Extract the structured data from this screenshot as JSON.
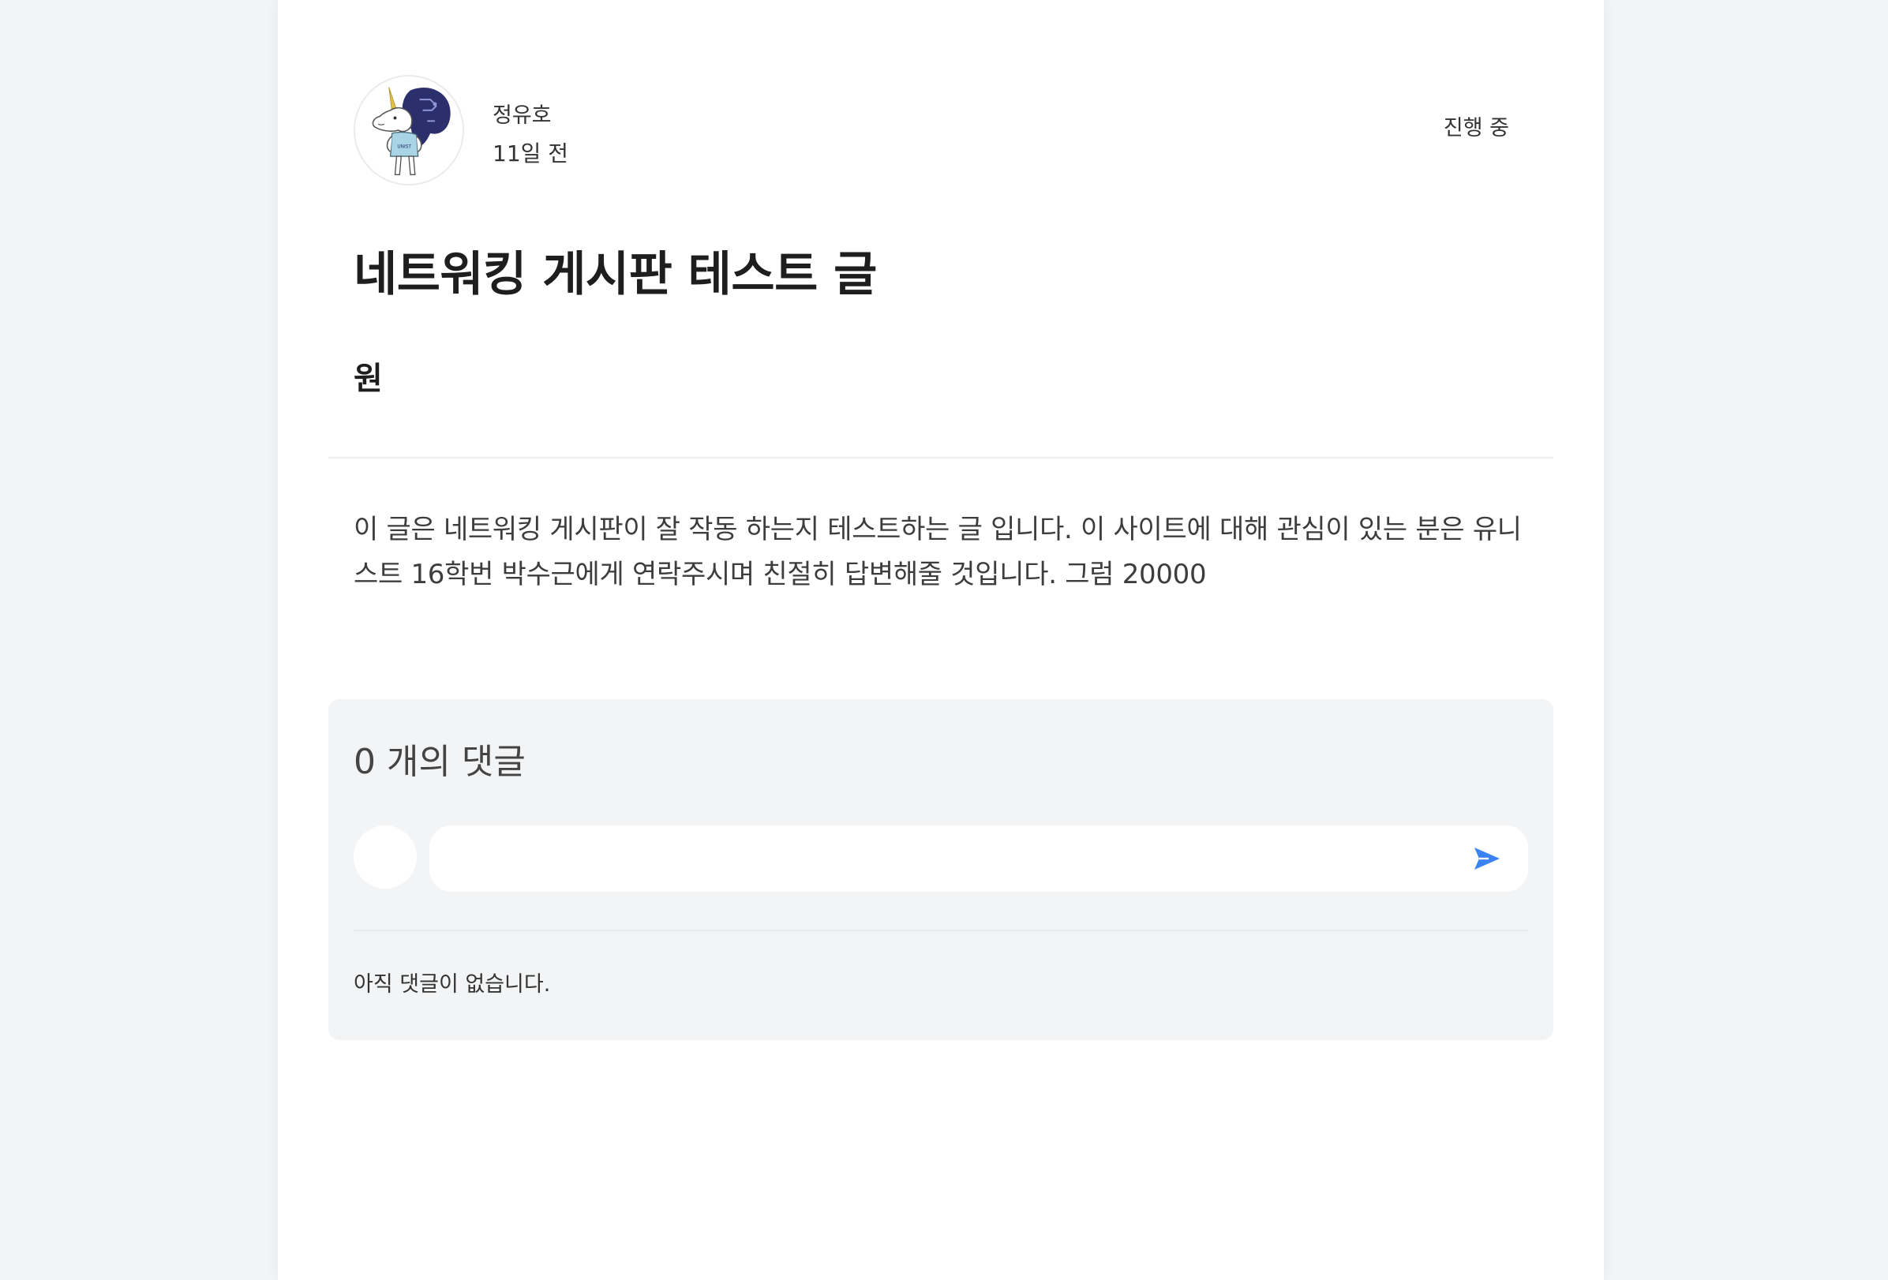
{
  "post": {
    "author": "정유호",
    "time_ago": "11일 전",
    "status": "진행 중",
    "title": "네트워킹 게시판 테스트 글",
    "price": "원",
    "body": "이 글은 네트워킹 게시판이 잘 작동 하는지 테스트하는 글 입니다. 이 사이트에 대해 관심이 있는 분은 유니스트 16학번 박수근에게 연락주시며 친절히 답변해줄 것입니다. 그럼 20000",
    "avatar_icon": "unicorn-mascot-icon"
  },
  "comments": {
    "count_label": "0 개의 댓글",
    "input_value": "",
    "send_icon": "send-icon",
    "empty_message": "아직 댓글이 없습니다."
  },
  "colors": {
    "page_background": "#f3f4f6",
    "card_background": "#ffffff",
    "accent": "#3b82f6",
    "text": "#222222"
  }
}
